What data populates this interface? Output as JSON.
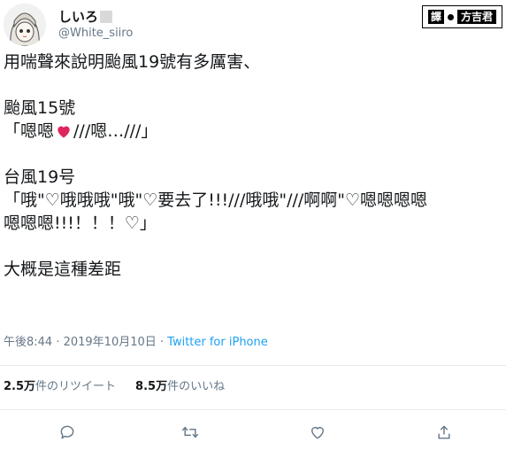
{
  "user": {
    "display_name": "しいろ",
    "handle": "@White_siiro"
  },
  "translator_badge": {
    "key": "譯",
    "name": "方吉君"
  },
  "tweet": {
    "line1": "用喘聲來說明颱風19號有多厲害、",
    "line2": "颱風15號",
    "line3_prefix": "「嗯嗯",
    "line3_suffix": "///嗯…///」",
    "line4": "台風19号",
    "line5": "「哦\"♡哦哦哦\"哦\"♡要去了!!!///哦哦\"///啊啊\"♡嗯嗯嗯嗯",
    "line6": "嗯嗯嗯!!!！！！♡」",
    "line7": "大概是這種差距"
  },
  "meta": {
    "time": "午後8:44 · 2019年10月10日 · ",
    "source": "Twitter for iPhone"
  },
  "stats": {
    "retweets_count": "2.5万",
    "retweets_label": "件のリツイート",
    "likes_count": "8.5万",
    "likes_label": "件のいいね"
  },
  "icons": {
    "reply": "reply-icon",
    "retweet": "retweet-icon",
    "like": "like-icon",
    "share": "share-icon",
    "heart_emoji": "red-heart-icon"
  },
  "colors": {
    "link": "#1da1f2",
    "muted": "#657786",
    "text": "#14171a",
    "heart": "#e0245e"
  }
}
